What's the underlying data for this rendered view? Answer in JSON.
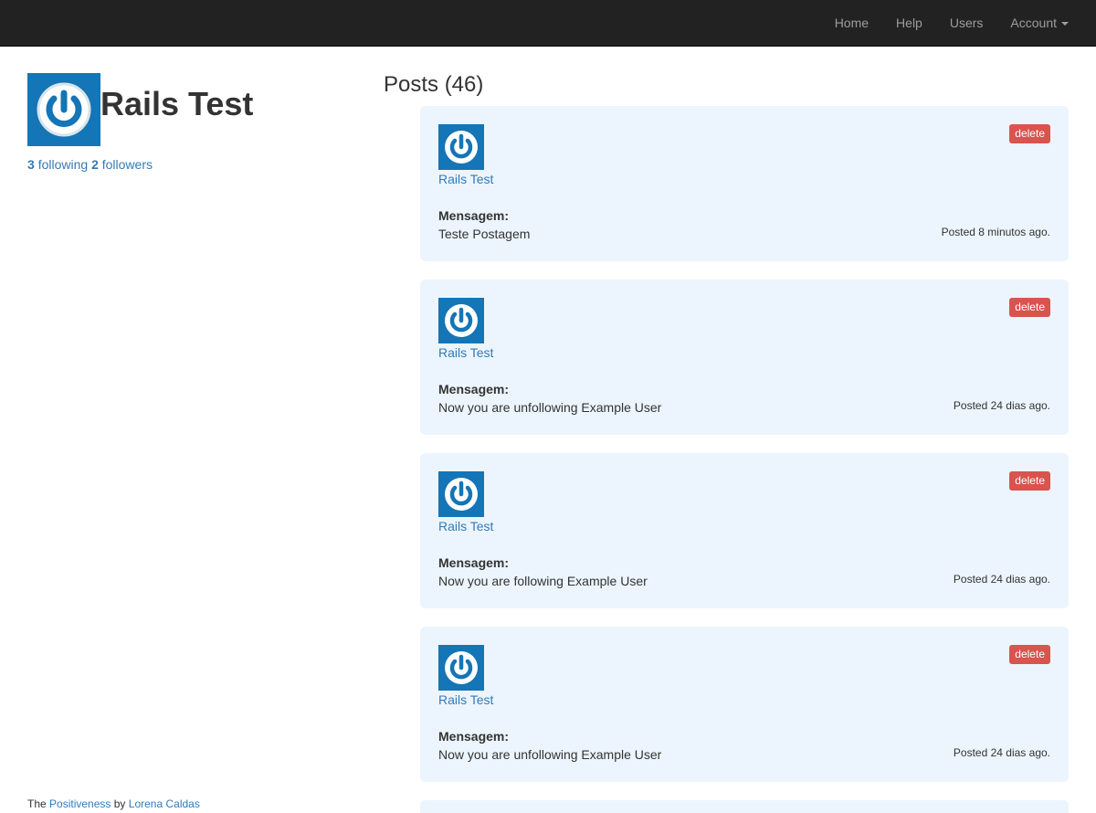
{
  "nav": {
    "links": [
      "Home",
      "Help",
      "Users"
    ],
    "account_label": "Account"
  },
  "user": {
    "name": "Rails Test",
    "following_count": "3",
    "following_label": "following",
    "followers_count": "2",
    "followers_label": "followers"
  },
  "posts": {
    "title": "Posts (46)",
    "items": [
      {
        "user": "Rails Test",
        "label": "Mensagem:",
        "content": "Teste Postagem",
        "time": "Posted 8 minutos ago.",
        "delete": "delete"
      },
      {
        "user": "Rails Test",
        "label": "Mensagem:",
        "content": "Now you are unfollowing Example User",
        "time": "Posted 24 dias ago.",
        "delete": "delete"
      },
      {
        "user": "Rails Test",
        "label": "Mensagem:",
        "content": "Now you are following Example User",
        "time": "Posted 24 dias ago.",
        "delete": "delete"
      },
      {
        "user": "Rails Test",
        "label": "Mensagem:",
        "content": "Now you are unfollowing Example User",
        "time": "Posted 24 dias ago.",
        "delete": "delete"
      }
    ]
  },
  "footer": {
    "prefix": "The",
    "app_link": "Positiveness",
    "by": "by",
    "author_link": "Lorena Caldas"
  },
  "colors": {
    "navbar": "#222222",
    "link": "#337ab7",
    "post_bg": "#ecf5fd",
    "delete": "#d9534f",
    "gravatar_bg": "#1475b7"
  }
}
